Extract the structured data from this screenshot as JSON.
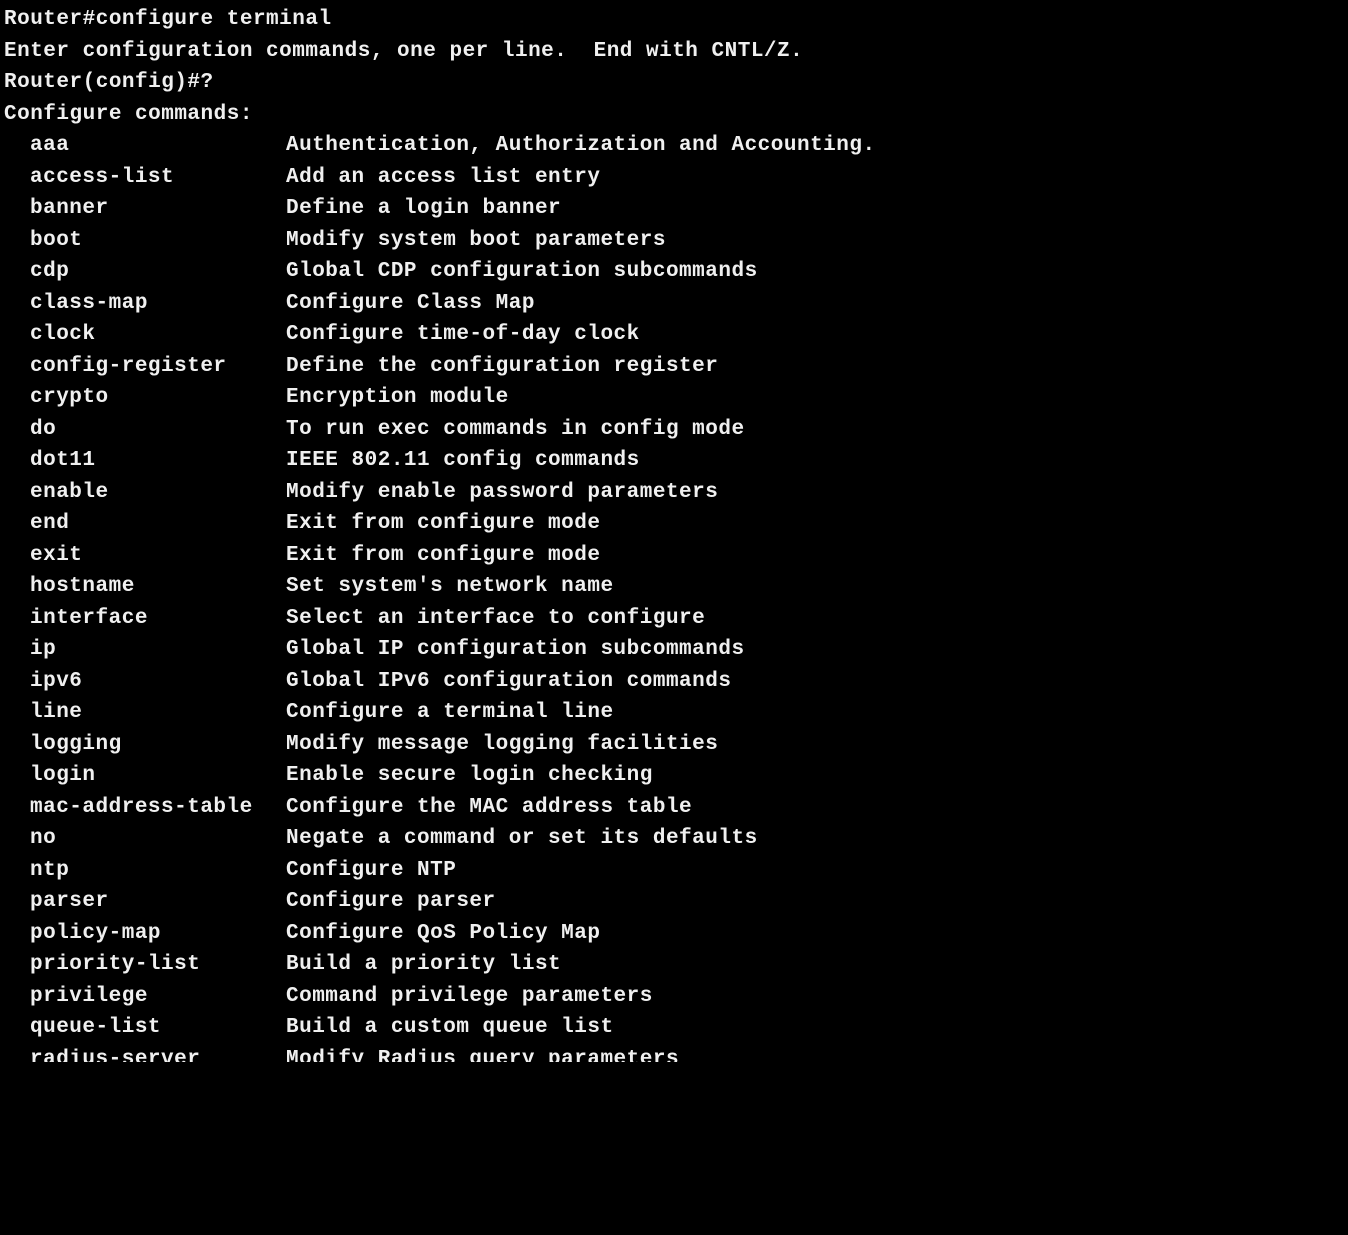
{
  "lines": {
    "prompt1": "Router#configure terminal",
    "info": "Enter configuration commands, one per line.  End with CNTL/Z.",
    "prompt2": "Router(config)#?",
    "header": "Configure commands:"
  },
  "commands": [
    {
      "name": "aaa",
      "desc": "Authentication, Authorization and Accounting."
    },
    {
      "name": "access-list",
      "desc": "Add an access list entry"
    },
    {
      "name": "banner",
      "desc": "Define a login banner"
    },
    {
      "name": "boot",
      "desc": "Modify system boot parameters"
    },
    {
      "name": "cdp",
      "desc": "Global CDP configuration subcommands"
    },
    {
      "name": "class-map",
      "desc": "Configure Class Map"
    },
    {
      "name": "clock",
      "desc": "Configure time-of-day clock"
    },
    {
      "name": "config-register",
      "desc": "Define the configuration register"
    },
    {
      "name": "crypto",
      "desc": "Encryption module"
    },
    {
      "name": "do",
      "desc": "To run exec commands in config mode"
    },
    {
      "name": "dot11",
      "desc": "IEEE 802.11 config commands"
    },
    {
      "name": "enable",
      "desc": "Modify enable password parameters"
    },
    {
      "name": "end",
      "desc": "Exit from configure mode"
    },
    {
      "name": "exit",
      "desc": "Exit from configure mode"
    },
    {
      "name": "hostname",
      "desc": "Set system's network name"
    },
    {
      "name": "interface",
      "desc": "Select an interface to configure"
    },
    {
      "name": "ip",
      "desc": "Global IP configuration subcommands"
    },
    {
      "name": "ipv6",
      "desc": "Global IPv6 configuration commands"
    },
    {
      "name": "line",
      "desc": "Configure a terminal line"
    },
    {
      "name": "logging",
      "desc": "Modify message logging facilities"
    },
    {
      "name": "login",
      "desc": "Enable secure login checking"
    },
    {
      "name": "mac-address-table",
      "desc": "Configure the MAC address table"
    },
    {
      "name": "no",
      "desc": "Negate a command or set its defaults"
    },
    {
      "name": "ntp",
      "desc": "Configure NTP"
    },
    {
      "name": "parser",
      "desc": "Configure parser"
    },
    {
      "name": "policy-map",
      "desc": "Configure QoS Policy Map"
    },
    {
      "name": "priority-list",
      "desc": "Build a priority list"
    },
    {
      "name": "privilege",
      "desc": "Command privilege parameters"
    },
    {
      "name": "queue-list",
      "desc": "Build a custom queue list"
    }
  ],
  "partial": {
    "name": "radius-server",
    "desc": "Modify Radius query parameters"
  }
}
